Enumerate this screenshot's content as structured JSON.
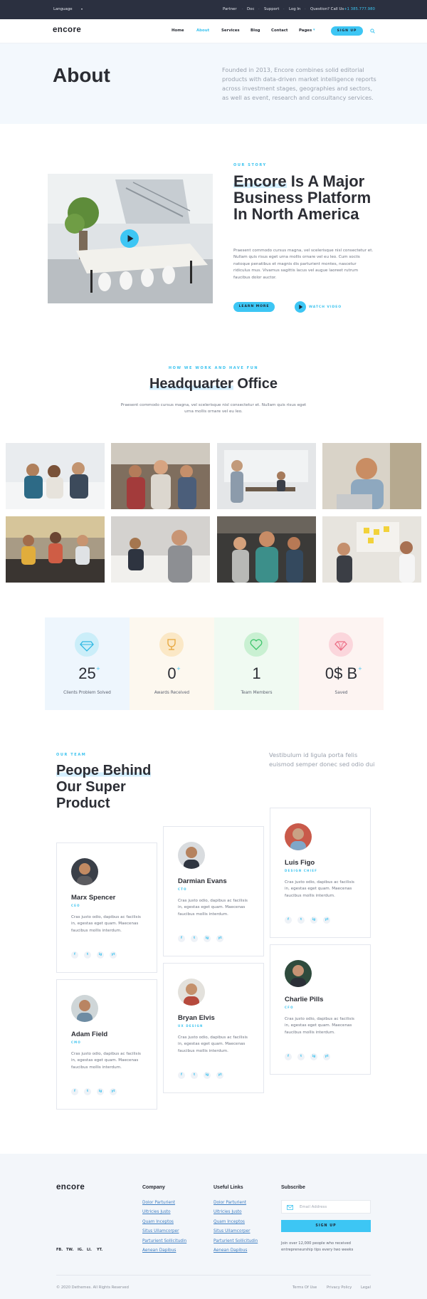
{
  "topbar": {
    "language": "Language",
    "links": [
      "Partner",
      "Doc",
      "Support",
      "Log In"
    ],
    "question": "Question? Call Us",
    "phone": "+1 385.777.980"
  },
  "header": {
    "logo": "encore",
    "nav": [
      "Home",
      "About",
      "Services",
      "Blog",
      "Contact",
      "Pages"
    ],
    "active": "About",
    "signup": "SIGN UP"
  },
  "hero": {
    "title": "About",
    "text": "Founded in 2013, Encore combines solid editorial products with data-driven market intelligence reports across investment stages, geographies and sectors, as well as event, research and consultancy services."
  },
  "story": {
    "eyebrow": "OUR STORY",
    "title_highlight": "Encore",
    "title_rest": "Is A Major Business Platform In North America",
    "text": "Praesent commodo cursus magna, vel scelerisque nisl consectetur et. Nullam quis risus eget urna mollis ornare vel eu leo. Cum sociis natoque penatibus et magnis dis parturient montes, nascetur ridiculus mus. Vivamus sagittis lacus vel augue laoreet rutrum faucibus dolor auctor.",
    "learn_more": "LEARN MORE",
    "watch_video": "WATCH VIDEO"
  },
  "hq": {
    "eyebrow": "HOW WE WORK AND HAVE FUN",
    "title_highlight": "Headquarter",
    "title_rest": "Office",
    "text": "Praesent commodo cursus magna, vel scelerisque nisl consectetur et. Nullam quis risus eget urna mollis ornare vel eu leo."
  },
  "stats": [
    {
      "value": "25",
      "plus": "+",
      "label": "Clients Problem Solved",
      "icon": "diamond-icon",
      "bg": "#eef6fd",
      "circle": "#cbeef9",
      "color": "#2fb8e3"
    },
    {
      "value": "0",
      "plus": "+",
      "label": "Awards Received",
      "icon": "trophy-icon",
      "bg": "#fdf8ef",
      "circle": "#fbe8c6",
      "color": "#e7a63b"
    },
    {
      "value": "1",
      "plus": "",
      "label": "Team Members",
      "icon": "heart-icon",
      "bg": "#f0faf2",
      "circle": "#c9f0d2",
      "color": "#3cc46a"
    },
    {
      "value": "0$ B",
      "plus": "+",
      "label": "Saved",
      "icon": "gem-icon",
      "bg": "#fdf4f2",
      "circle": "#fbd6dc",
      "color": "#ec6f86"
    }
  ],
  "team": {
    "eyebrow": "OUR TEAM",
    "title_highlight": "Peope Behind",
    "title_rest": "Our Super Product",
    "side_text": "Vestibulum id ligula porta felis euismod semper donec sed odio dui",
    "bio": "Cras justo odio, dapibus ac facilisis in, egestas eget quam. Maecenas faucibus mollis interdum.",
    "social": [
      "f",
      "t",
      "ig",
      "yt"
    ],
    "members": [
      {
        "name": "Marx Spencer",
        "role": "CEO"
      },
      {
        "name": "Darmian Evans",
        "role": "CTO"
      },
      {
        "name": "Luis Figo",
        "role": "DESIGN CHIEF"
      },
      {
        "name": "Adam Field",
        "role": "CMO"
      },
      {
        "name": "Bryan Elvis",
        "role": "UX DESIGN"
      },
      {
        "name": "Charlie Pills",
        "role": "CFO"
      }
    ]
  },
  "footer": {
    "logo": "encore",
    "social": [
      "FB.",
      "TW.",
      "IG.",
      "LI.",
      "YT."
    ],
    "company_title": "Company",
    "company_links": [
      "Dolor Parturient",
      "Ultricies Justo",
      "Quam Inceptos",
      "Situs Ullamcorper",
      "Parturient Sollicitudin",
      "Aenean Dapibus"
    ],
    "useful_title": "Useful Links",
    "useful_links": [
      "Dolor Parturient",
      "Ultricies Justo",
      "Quam Inceptos",
      "Situs Ullamcorper",
      "Parturient Sollicitudin",
      "Aenean Dapibus"
    ],
    "subscribe_title": "Subscribe",
    "email_placeholder": "Email Address",
    "signup": "SIGN UP",
    "subscribe_note": "Join over 12,000 people who received entrepreneurship tips every two weeks",
    "copyright": "© 2020 Dethemes. All Rights Reserved",
    "legal_links": [
      "Terms Of Use",
      "Privacy Policy",
      "Legal"
    ]
  }
}
